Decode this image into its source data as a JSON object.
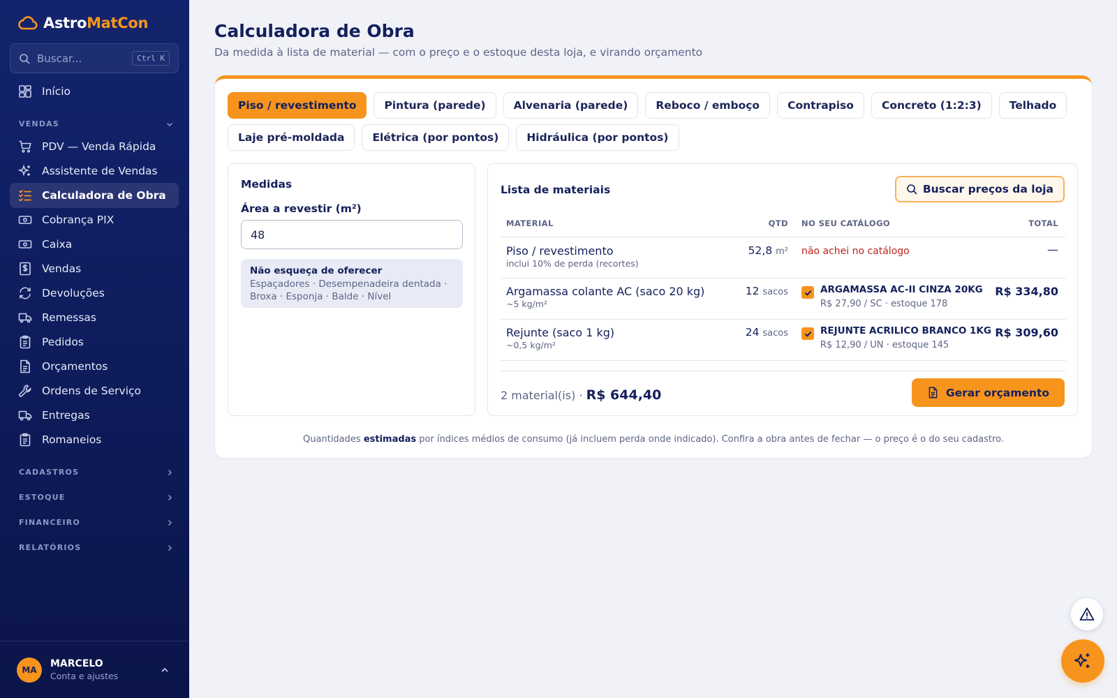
{
  "brand": {
    "name_part1": "Astro",
    "name_part2": "MatCon",
    "logo_icon": "cloud-icon"
  },
  "search": {
    "placeholder": "Buscar...",
    "shortcut": "Ctrl K"
  },
  "nav": {
    "home": {
      "label": "Início",
      "icon": "dashboard-icon"
    },
    "sections": {
      "vendas": "VENDAS",
      "cadastros": "CADASTROS",
      "estoque": "ESTOQUE",
      "financeiro": "FINANCEIRO",
      "relatorios": "RELATÓRIOS"
    },
    "items": [
      {
        "label": "PDV — Venda Rápida",
        "icon": "cart-icon"
      },
      {
        "label": "Assistente de Vendas",
        "icon": "sparkles-icon"
      },
      {
        "label": "Calculadora de Obra",
        "icon": "list-check-icon",
        "active": true
      },
      {
        "label": "Cobrança PIX",
        "icon": "banknote-icon"
      },
      {
        "label": "Caixa",
        "icon": "banknote-icon"
      },
      {
        "label": "Vendas",
        "icon": "receipt-dollar-icon"
      },
      {
        "label": "Devoluções",
        "icon": "refresh-icon"
      },
      {
        "label": "Remessas",
        "icon": "truck-icon"
      },
      {
        "label": "Pedidos",
        "icon": "clipboard-icon"
      },
      {
        "label": "Orçamentos",
        "icon": "document-icon"
      },
      {
        "label": "Ordens de Serviço",
        "icon": "wrench-icon"
      },
      {
        "label": "Entregas",
        "icon": "truck-icon"
      },
      {
        "label": "Romaneios",
        "icon": "clipboard-icon"
      }
    ]
  },
  "user": {
    "initials": "MA",
    "name": "MARCELO",
    "subtitle": "Conta e ajustes"
  },
  "page": {
    "title": "Calculadora de Obra",
    "subtitle": "Da medida à lista de material — com o preço e o estoque desta loja, e virando orçamento"
  },
  "tabs": {
    "row1": [
      "Piso / revestimento",
      "Pintura (parede)",
      "Alvenaria (parede)",
      "Reboco / emboço",
      "Contrapiso",
      "Concreto (1:2:3)",
      "Telhado"
    ],
    "row2": [
      "Laje pré-moldada",
      "Elétrica (por pontos)",
      "Hidráulica (por pontos)"
    ],
    "active": "Piso / revestimento"
  },
  "measures": {
    "title": "Medidas",
    "field_label": "Área a revestir (m²)",
    "field_value": "48",
    "tip_title": "Não esqueça de oferecer",
    "tip_body": "Espaçadores · Desempenadeira dentada · Broxa · Esponja · Balde · Nível"
  },
  "materials": {
    "title": "Lista de materiais",
    "search_prices_label": "Buscar preços da loja",
    "headers": {
      "material": "MATERIAL",
      "qty": "QTD",
      "catalog": "NO SEU CATÁLOGO",
      "total": "TOTAL"
    },
    "rows": [
      {
        "name": "Piso / revestimento",
        "note": "inclui 10% de perda (recortes)",
        "qty": "52,8",
        "unit": "m²",
        "catalog_status": "não achei no catálogo",
        "total": "—"
      },
      {
        "name": "Argamassa colante AC (saco 20 kg)",
        "note": "~5 kg/m²",
        "qty": "12",
        "unit": "sacos",
        "catalog_name": "ARGAMASSA AC-II CINZA 20KG",
        "catalog_info": "R$ 27,90 / SC · estoque 178",
        "checked": true,
        "total": "R$ 334,80"
      },
      {
        "name": "Rejunte (saco 1 kg)",
        "note": "~0,5 kg/m²",
        "qty": "24",
        "unit": "sacos",
        "catalog_name": "REJUNTE ACRILICO BRANCO 1KG",
        "catalog_info": "R$ 12,90 / UN · estoque 145",
        "checked": true,
        "total": "R$ 309,60"
      }
    ],
    "summary_count": "2 material(is) ·",
    "summary_total": "R$ 644,40",
    "generate_label": "Gerar orçamento"
  },
  "footnote": {
    "part1": "Quantidades ",
    "bold": "estimadas",
    "part2": " por índices médios de consumo (já incluem perda onde indicado). Confira a obra antes de fechar — o preço é o do seu cadastro."
  },
  "colors": {
    "accent": "#f7941d",
    "sidebar": "#0f1d5e",
    "error": "#c0231f",
    "text": "#14205c"
  }
}
